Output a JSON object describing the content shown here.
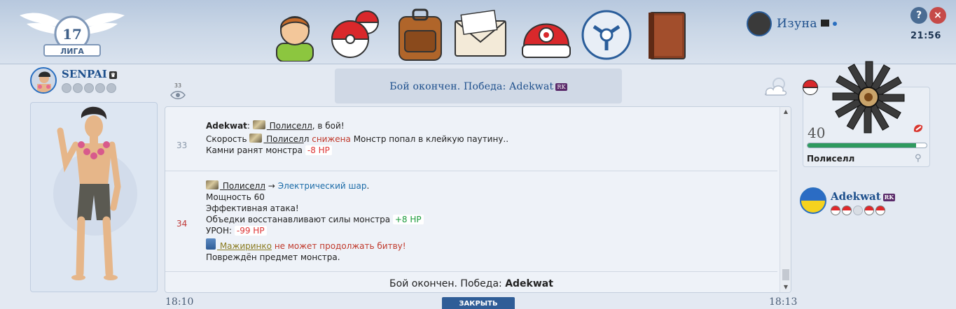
{
  "header": {
    "league_number": "17",
    "league_label": "ЛИГА",
    "nav_icons": [
      "trainer-icon",
      "pokeballs-icon",
      "backpack-icon",
      "mail-icon",
      "cap-icon",
      "team-icon",
      "journal-icon"
    ],
    "user": {
      "name": "Изуна"
    },
    "help_label": "?",
    "close_label": "×",
    "clock": "21:56"
  },
  "player": {
    "name": "SENPAI",
    "balls": [
      "empty",
      "empty",
      "empty",
      "empty",
      "empty"
    ]
  },
  "viewers": "33",
  "battle": {
    "banner_text": "Бой окончен. Победа: Adekwat",
    "banner_tag": "RK"
  },
  "log": {
    "entries": [
      {
        "turn": "33",
        "lines": {
          "l1_name": "Adekwat",
          "l1_colon": ":",
          "l1_monster": " Полиселл",
          "l1_end": ", в бой!",
          "l2_start": "Скорость",
          "l2_monster": " Полисел",
          "l2_mid": "л",
          "l2_bad": "снижена",
          "l2_end": "Монстр попал в клейкую паутину..",
          "l3_text": "Камни ранят монстра",
          "l3_hp": "-8 HP"
        }
      },
      {
        "turn": "34",
        "lines": {
          "l1_monster": " Полиселл",
          "l1_arrow": "→",
          "l1_move": "Электрический шар",
          "l1_dot": ".",
          "l2": "Мощность 60",
          "l3": "Эффективная атака!",
          "l4_text": "Объедки восстанавливают силы монстра",
          "l4_hp": "+8 HP",
          "l5_text": "УРОН:",
          "l5_hp": "-99 HP",
          "l6_monster": " Мажиринко",
          "l6_bad": "не может продолжать битву!",
          "l7": "Повреждён предмет монстра."
        }
      }
    ],
    "summary_text": "Бой окончен. Победа:",
    "summary_winner": "Adekwat"
  },
  "footer": {
    "time_left": "18:10",
    "close_button": "ЗАКРЫТЬ",
    "time_right": "18:13"
  },
  "enemy": {
    "level": "40",
    "monster_name": "Полиселл",
    "gender": "⚲",
    "hp_fraction": 0.91
  },
  "opponent": {
    "name": "Adekwat",
    "tag": "RK",
    "balls": [
      "full",
      "full",
      "faint",
      "full",
      "full"
    ]
  },
  "colors": {
    "accent": "#1d4f8c",
    "hp_green": "#2e9a5e",
    "bad_red": "#c0392b",
    "move_blue": "#1c6ca8"
  }
}
